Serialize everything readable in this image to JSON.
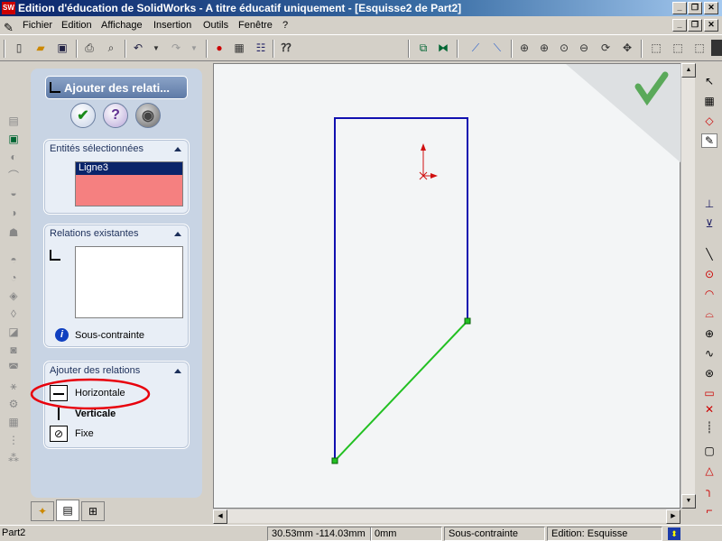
{
  "window": {
    "title": "Edition d'éducation de SolidWorks - A titre éducatif uniquement - [Esquisse2 de Part2]",
    "logo": "SW",
    "minimize": "_",
    "restore": "❐",
    "close": "✕"
  },
  "menu": {
    "items": [
      "Fichier",
      "Edition",
      "Affichage",
      "Insertion",
      "Outils",
      "Fenêtre",
      "?"
    ]
  },
  "panel": {
    "command_title": "Ajouter des relati...",
    "ok_icon": "✔",
    "help_icon": "?",
    "pin_icon": "◉",
    "selected_entities": {
      "header": "Entités sélectionnées",
      "items": [
        "Ligne3"
      ]
    },
    "existing_relations": {
      "header": "Relations existantes",
      "status": "Sous-contrainte"
    },
    "add_relations": {
      "header": "Ajouter des relations",
      "options": [
        {
          "label": "Horizontale",
          "bold": false
        },
        {
          "label": "Verticale",
          "bold": true
        },
        {
          "label": "Fixe",
          "bold": false
        }
      ]
    }
  },
  "status": {
    "part": "Part2",
    "coords": "30.53mm -114.03mm",
    "z": "0mm",
    "constraint": "Sous-contrainte",
    "mode": "Edition: Esquisse"
  },
  "colors": {
    "sketch_line": "#1010b0",
    "selected_line": "#22c022",
    "accent": "#0a246a",
    "highlight": "#e8000c"
  }
}
